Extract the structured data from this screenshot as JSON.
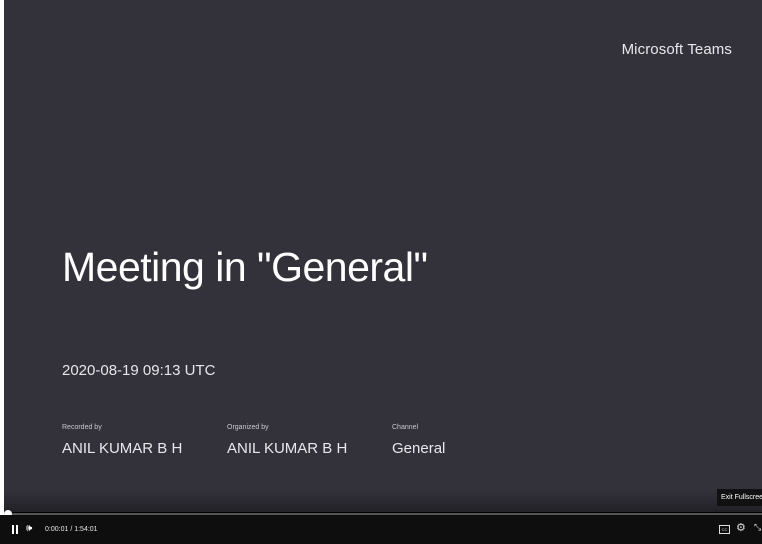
{
  "slide": {
    "brand": "Microsoft Teams",
    "title": "Meeting in \"General\"",
    "datetime": "2020-08-19 09:13 UTC",
    "recorded_by_label": "Recorded by",
    "recorded_by": "ANIL KUMAR B H",
    "organized_by_label": "Organized by",
    "organized_by": "ANIL KUMAR B H",
    "channel_label": "Channel",
    "channel": "General"
  },
  "player": {
    "current_time": "0:00:01",
    "separator": "/",
    "duration": "1:54:01",
    "progress_fraction": 0.0001,
    "tooltip": "Exit Fullscreen",
    "cc_icon": "closed-captions-icon",
    "settings_icon": "gear-icon",
    "exit_icon": "exit-fullscreen-icon"
  },
  "colors": {
    "slide_background": "#33323b",
    "controls_background": "#0e0e0e"
  }
}
